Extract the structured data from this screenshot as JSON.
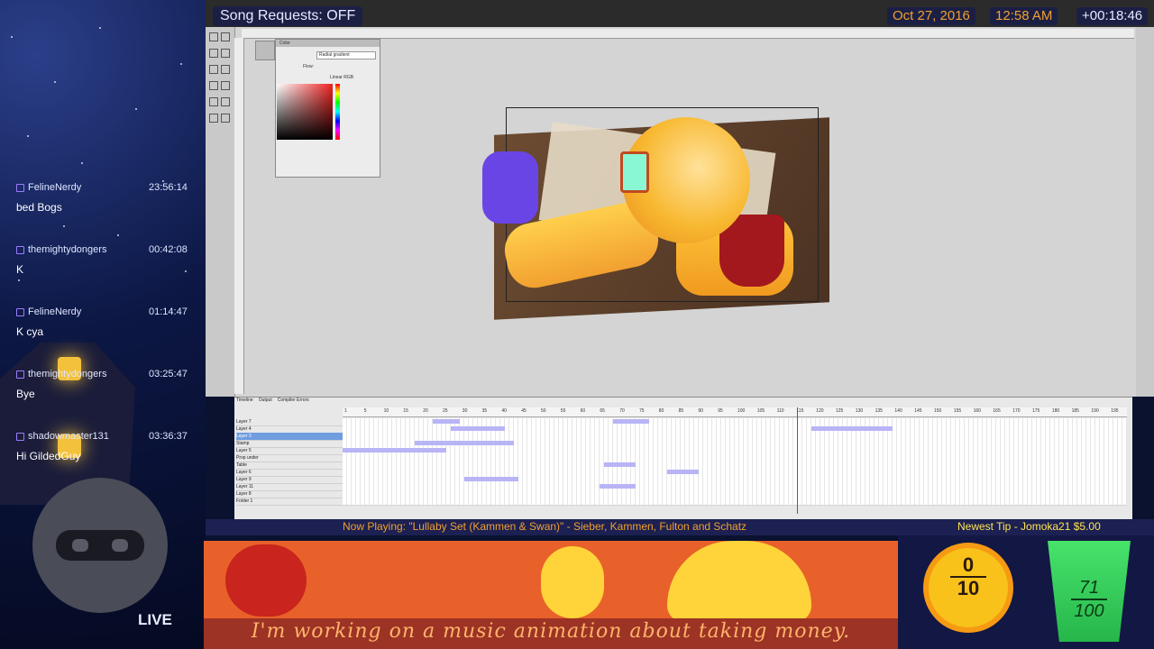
{
  "stream": {
    "song_requests": "Song Requests: OFF",
    "date": "Oct 27, 2016",
    "time": "12:58 AM",
    "uptime": "+00:18:46",
    "live_label": "LIVE"
  },
  "chat": {
    "messages": [
      {
        "user": "FelineNerdy",
        "time": "23:56:14",
        "text": "bed Bogs"
      },
      {
        "user": "themightydongers",
        "time": "00:42:08",
        "text": "K"
      },
      {
        "user": "FelineNerdy",
        "time": "01:14:47",
        "text": "K cya"
      },
      {
        "user": "themightydongers",
        "time": "03:25:47",
        "text": "Bye"
      },
      {
        "user": "shadowmaster131",
        "time": "03:36:37",
        "text": "Hi GildedGuy"
      }
    ]
  },
  "flash": {
    "color_panel_title": "Color",
    "gradient_type": "Radial gradient",
    "flow_label": "Flow:",
    "linear_rgb": "Linear RGB",
    "timeline_tabs": [
      "Timeline",
      "Output",
      "Compiler Errors"
    ],
    "layers": [
      "Layer 7",
      "Layer 4",
      "Layer 3",
      "Stamp",
      "Layer 5",
      "Prop under",
      "Table",
      "Layer 6",
      "Layer 9",
      "Layer 11",
      "Layer 8",
      "Folder 1"
    ],
    "frame_ticks": [
      "1",
      "5",
      "10",
      "15",
      "20",
      "25",
      "30",
      "35",
      "40",
      "45",
      "50",
      "55",
      "60",
      "65",
      "70",
      "75",
      "80",
      "85",
      "90",
      "95",
      "100",
      "105",
      "110",
      "115",
      "120",
      "125",
      "130",
      "135",
      "140",
      "145",
      "150",
      "155",
      "160",
      "165",
      "170",
      "175",
      "180",
      "185",
      "190",
      "195"
    ],
    "current_frame": "117"
  },
  "now_playing": "Now Playing: \"Lullaby Set (Kammen & Swan)\" - Sieber, Kammen, Fulton and Schatz",
  "newest_tip": "Newest Tip - Jomoka21 $5.00",
  "banner_text": "I'm working on a music animation about taking money.",
  "goals": {
    "sun_top": "0",
    "sun_bottom": "10",
    "cup_top": "71",
    "cup_bottom": "100"
  },
  "colors": {
    "accent_orange": "#f0a030",
    "tip_yellow": "#ffe552",
    "playhead_red": "#e0262b",
    "tween_purple": "#b8b4f6"
  }
}
